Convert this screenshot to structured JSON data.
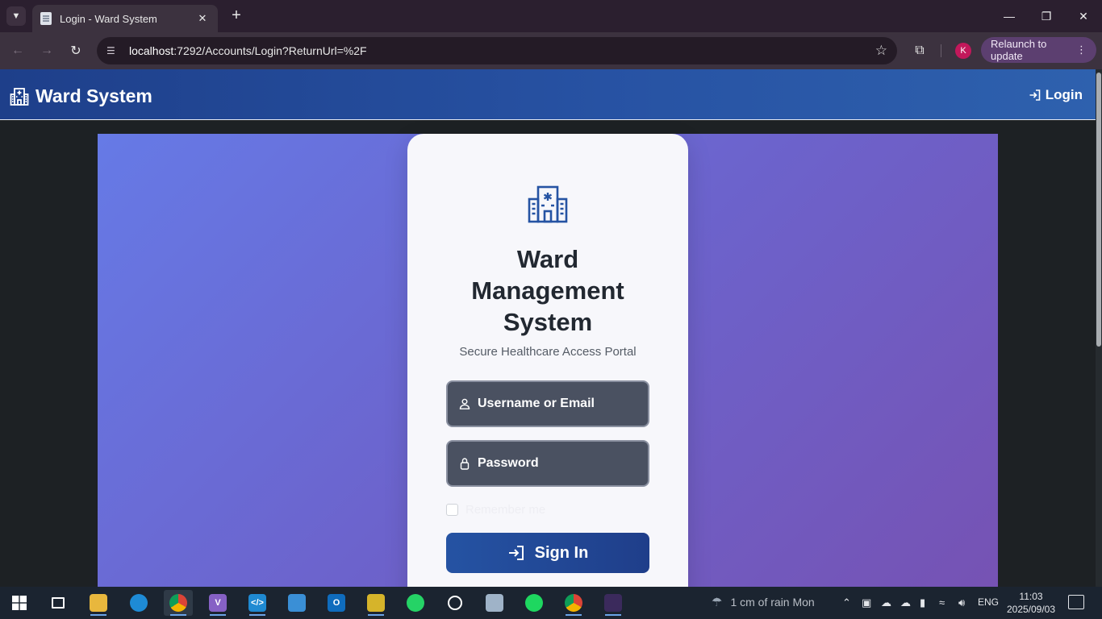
{
  "browser": {
    "tab_title": "Login - Ward System",
    "url_host": "localhost",
    "url_rest": ":7292/Accounts/Login?ReturnUrl=%2F",
    "avatar_initial": "K",
    "relaunch_label": "Relaunch to update"
  },
  "site": {
    "brand": "Ward System",
    "nav_login": "Login"
  },
  "login": {
    "title_line1": "Ward",
    "title_line2": "Management",
    "title_line3": "System",
    "subtitle": "Secure Healthcare Access Portal",
    "username_placeholder": "Username or Email",
    "password_placeholder": "Password",
    "remember_label": "Remember me",
    "signin_label": "Sign In"
  },
  "taskbar": {
    "weather": "1 cm of rain Mon",
    "language": "ENG",
    "time": "11:03",
    "date": "2025/09/03",
    "apps": [
      "windows-start",
      "task-view",
      "file-explorer",
      "edge",
      "chrome",
      "visual-studio",
      "vscode",
      "control-panel",
      "outlook",
      "image-editor",
      "whatsapp",
      "app-circle",
      "photos",
      "spotify",
      "chrome-profile",
      "terminal"
    ]
  },
  "colors": {
    "nav_gradient_start": "#1e3f8a",
    "nav_gradient_end": "#2e61ae",
    "hero_gradient_start": "#667ae6",
    "hero_gradient_end": "#7652b3",
    "signin_button": "#2553a3",
    "field_bg": "#4a5161"
  }
}
